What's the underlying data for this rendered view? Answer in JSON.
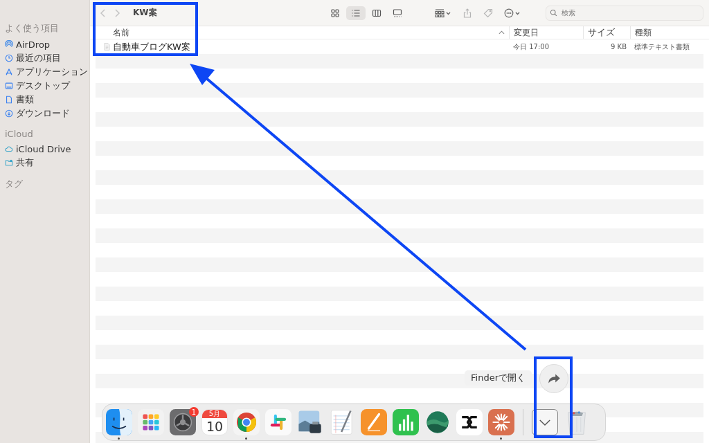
{
  "sidebar": {
    "sections": [
      {
        "title": "よく使う項目",
        "items": [
          {
            "label": "AirDrop",
            "kind": "airdrop"
          },
          {
            "label": "最近の項目",
            "kind": "clock"
          },
          {
            "label": "アプリケーション",
            "kind": "apps"
          },
          {
            "label": "デスクトップ",
            "kind": "desktop"
          },
          {
            "label": "書類",
            "kind": "doc"
          },
          {
            "label": "ダウンロード",
            "kind": "download"
          }
        ]
      },
      {
        "title": "iCloud",
        "items": [
          {
            "label": "iCloud Drive",
            "kind": "cloud"
          },
          {
            "label": "共有",
            "kind": "shared"
          }
        ]
      },
      {
        "title": "タグ"
      }
    ]
  },
  "toolbar": {
    "title": "KW案",
    "views": [
      {
        "kind": "icons",
        "selected": false
      },
      {
        "kind": "list",
        "selected": true
      },
      {
        "kind": "columns",
        "selected": false
      },
      {
        "kind": "gallery",
        "selected": false
      }
    ],
    "search": {
      "placeholder": "検索"
    }
  },
  "table": {
    "columns": [
      {
        "label": "名前",
        "sorted": true
      },
      {
        "label": "変更日",
        "sorted": false
      },
      {
        "label": "サイズ",
        "sorted": false
      },
      {
        "label": "種類",
        "sorted": false
      }
    ],
    "rows": [
      {
        "name": "自動車ブログKW案",
        "modified": "今日 17:00",
        "size": "9 KB",
        "type": "標準テキスト書類"
      }
    ]
  },
  "tooltip": "Finderで開く",
  "dock": {
    "items": [
      {
        "kind": "finder",
        "running": true
      },
      {
        "kind": "launchpad",
        "running": false
      },
      {
        "kind": "settings",
        "running": false,
        "badge": "1"
      },
      {
        "kind": "calendar",
        "running": false,
        "month": "5月",
        "day": "10"
      },
      {
        "kind": "chrome",
        "running": true
      },
      {
        "kind": "slack",
        "running": false
      },
      {
        "kind": "preview",
        "running": false
      },
      {
        "kind": "textedit",
        "running": false
      },
      {
        "kind": "pages",
        "running": false
      },
      {
        "kind": "numbers",
        "running": false
      },
      {
        "kind": "hills",
        "running": false
      },
      {
        "kind": "capcut",
        "running": false
      },
      {
        "kind": "claude",
        "running": true
      },
      {
        "kind": "stack",
        "running": false
      },
      {
        "kind": "trash",
        "running": false
      }
    ]
  }
}
